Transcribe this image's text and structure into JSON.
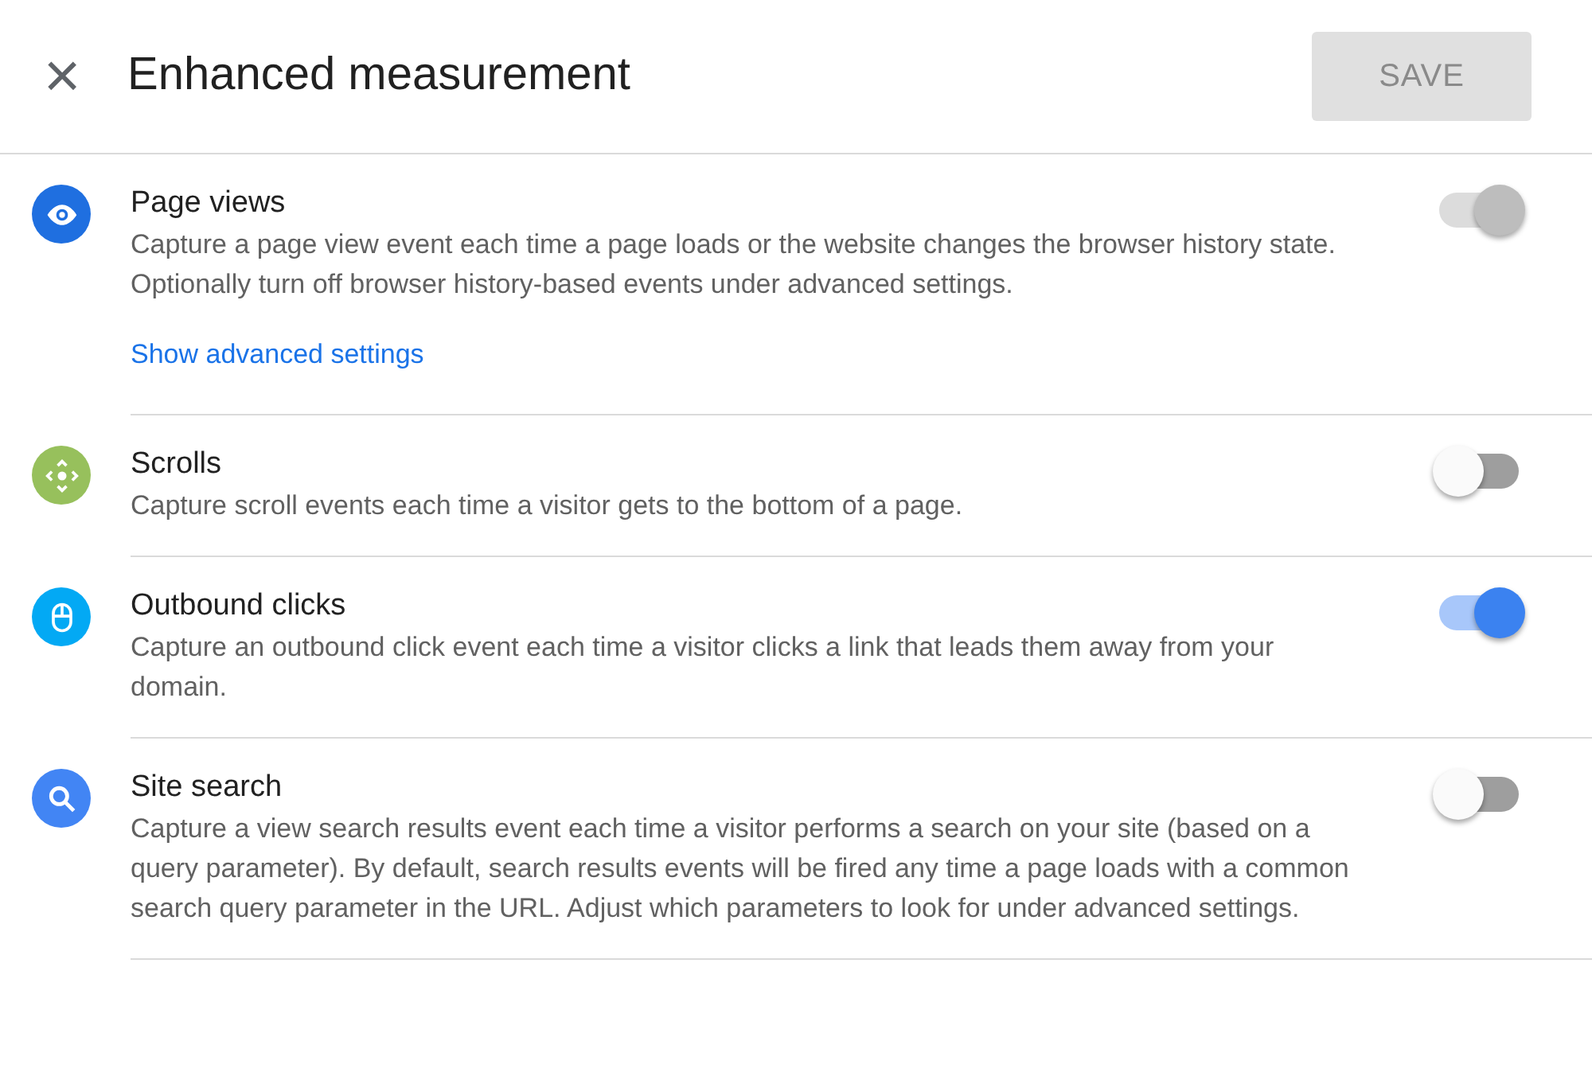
{
  "header": {
    "close": "×",
    "title": "Enhanced measurement",
    "save": {
      "label": "SAVE",
      "disabled": true
    }
  },
  "settings": [
    {
      "kind": "eye",
      "color": "#1f6fe0",
      "title": "Page views",
      "description": "Capture a page view event each time a page loads or the website changes the browser history state. Optionally turn off browser history-based events under advanced settings.",
      "link": "Show advanced settings",
      "on": true,
      "disabled": true
    },
    {
      "kind": "scroll",
      "color": "#97c05c",
      "title": "Scrolls",
      "description": "Capture scroll events each time a visitor gets to the bottom of a page.",
      "on": false,
      "disabled": false
    },
    {
      "kind": "mouse",
      "color": "#03a9f4",
      "title": "Outbound clicks",
      "description": "Capture an outbound click event each time a visitor clicks a link that leads them away from your domain.",
      "on": true,
      "disabled": false
    },
    {
      "kind": "search",
      "color": "#4285f4",
      "title": "Site search",
      "description": "Capture a view search results event each time a visitor performs a search on your site (based on a query parameter). By default, search results events will be fired any time a page loads with a common search query parameter in the URL. Adjust which parameters to look for under advanced settings.",
      "on": false,
      "disabled": false
    }
  ]
}
